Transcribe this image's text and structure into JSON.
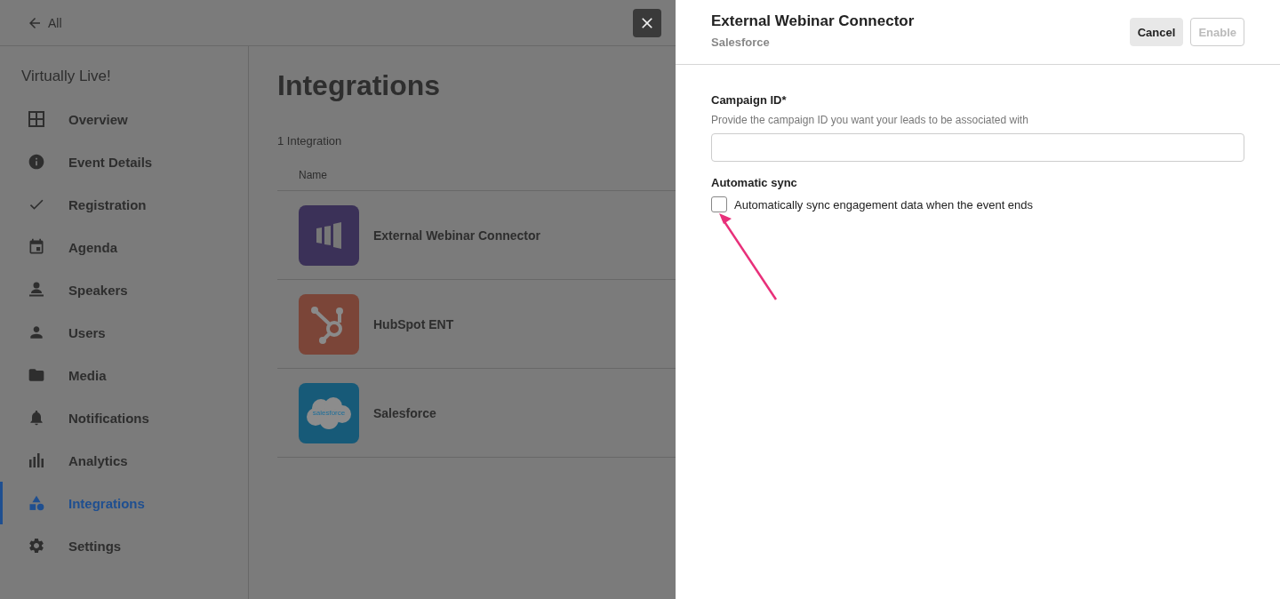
{
  "back_link": {
    "label": "All"
  },
  "sidebar": {
    "title": "Virtually Live!",
    "items": [
      {
        "label": "Overview",
        "kind": "overview",
        "selected": false
      },
      {
        "label": "Event Details",
        "kind": "info",
        "selected": false
      },
      {
        "label": "Registration",
        "kind": "check",
        "selected": false
      },
      {
        "label": "Agenda",
        "kind": "calendar",
        "selected": false
      },
      {
        "label": "Speakers",
        "kind": "speaker",
        "selected": false
      },
      {
        "label": "Users",
        "kind": "user",
        "selected": false
      },
      {
        "label": "Media",
        "kind": "folder",
        "selected": false
      },
      {
        "label": "Notifications",
        "kind": "bell",
        "selected": false
      },
      {
        "label": "Analytics",
        "kind": "chart",
        "selected": false
      },
      {
        "label": "Integrations",
        "kind": "shapes",
        "selected": true
      },
      {
        "label": "Settings",
        "kind": "gear",
        "selected": false
      }
    ]
  },
  "main": {
    "title": "Integrations",
    "count": "1 Integration",
    "table": {
      "columns": [
        "Name"
      ],
      "rows": [
        {
          "name": "External Webinar Connector",
          "kind": "webinar"
        },
        {
          "name": "HubSpot ENT",
          "kind": "hubspot"
        },
        {
          "name": "Salesforce",
          "kind": "salesforce",
          "logo_text": "salesforce"
        }
      ]
    }
  },
  "drawer": {
    "title": "External Webinar Connector",
    "subtitle": "Salesforce",
    "buttons": [
      {
        "label": "Cancel",
        "disabled": false
      },
      {
        "label": "Enable",
        "disabled": true
      }
    ],
    "campaign": {
      "label": "Campaign ID*",
      "hint": "Provide the campaign ID you want your leads to be associated with"
    },
    "sync": {
      "label": "Automatic sync",
      "checkbox": {
        "label": "Automatically sync engagement data when the event ends",
        "checked": false
      }
    }
  }
}
